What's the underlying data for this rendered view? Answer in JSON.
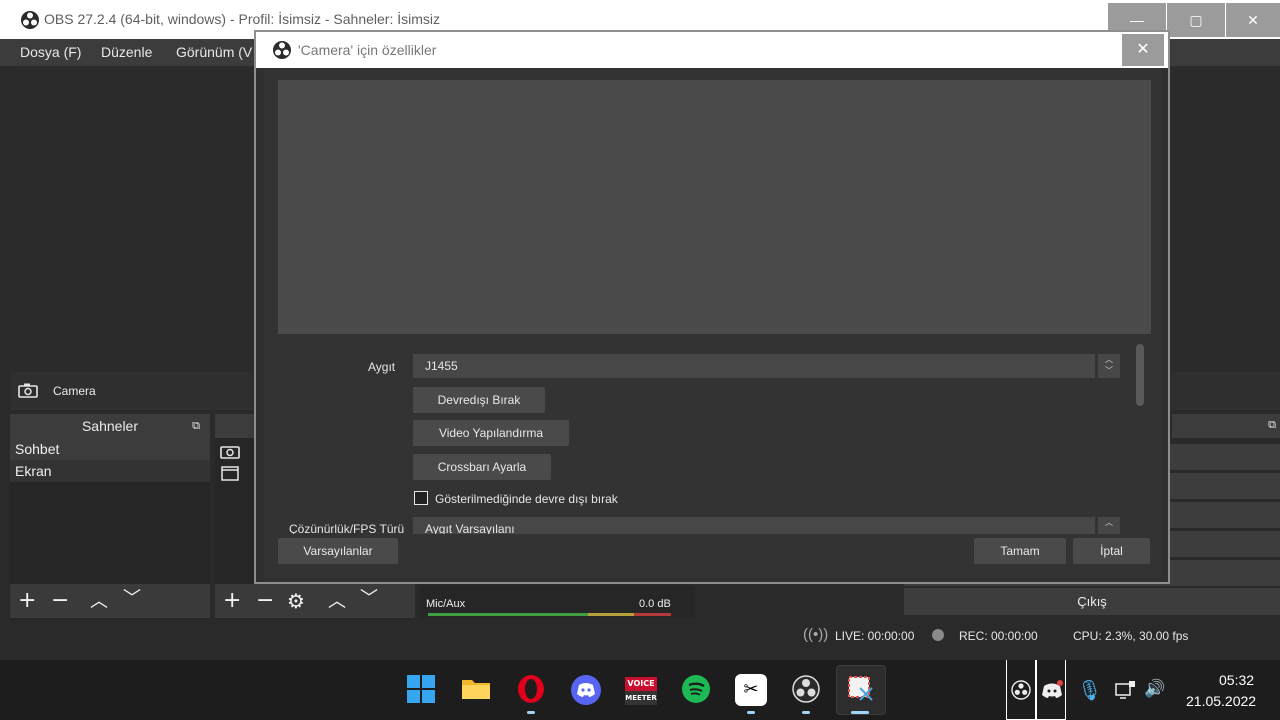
{
  "obs": {
    "title": "OBS 27.2.4 (64-bit, windows) - Profil: İsimsiz - Sahneler: İsimsiz",
    "minimize_glyph": "—",
    "maximize_glyph": "▢",
    "close_glyph": "✕",
    "menu": [
      "Dosya (F)",
      "Düzenle",
      "Görünüm (V"
    ],
    "source_bar_label": "Camera",
    "scenes_header": "Sahneler",
    "scenes": [
      "Sohbet",
      "Ekran"
    ],
    "mixer_channel": "Mic/Aux",
    "mixer_db": "0.0 dB",
    "exit_button": "Çıkış",
    "status": {
      "live": "LIVE: 00:00:00",
      "rec": "REC: 00:00:00",
      "cpu": "CPU: 2.3%, 30.00 fps"
    }
  },
  "dialog": {
    "title": "'Camera' için özellikler",
    "close_glyph": "✕",
    "device_label": "Aygıt",
    "device_value": "J1455",
    "deactivate_button": "Devredışı Bırak",
    "video_config_button": "Video Yapılandırma",
    "crossbar_button": "Crossbarı Ayarla",
    "checkbox_label": "Gösterilmediğinde devre dışı bırak",
    "checkbox_checked": false,
    "resolution_label": "Çözünürlük/FPS Türü",
    "resolution_value": "Aygıt Varsayılanı",
    "defaults_button": "Varsayılanlar",
    "ok_button": "Tamam",
    "cancel_button": "İptal"
  },
  "taskbar": {
    "apps": [
      "start",
      "file-explorer",
      "opera",
      "discord",
      "voicemeeter",
      "spotify",
      "capcut",
      "obs",
      "snipping-tool"
    ],
    "voicemeeter_text_top": "VOICE",
    "voicemeeter_text_bottom": "MEETER",
    "time": "05:32",
    "date": "21.05.2022"
  },
  "colors": {
    "accent": "#9fd3f5",
    "opera": "#e0001b",
    "discord": "#5865f2",
    "spotify": "#1db954",
    "meter_green": "#3f9e3f",
    "meter_yellow": "#b5a23a",
    "meter_red": "#b53a3a"
  }
}
